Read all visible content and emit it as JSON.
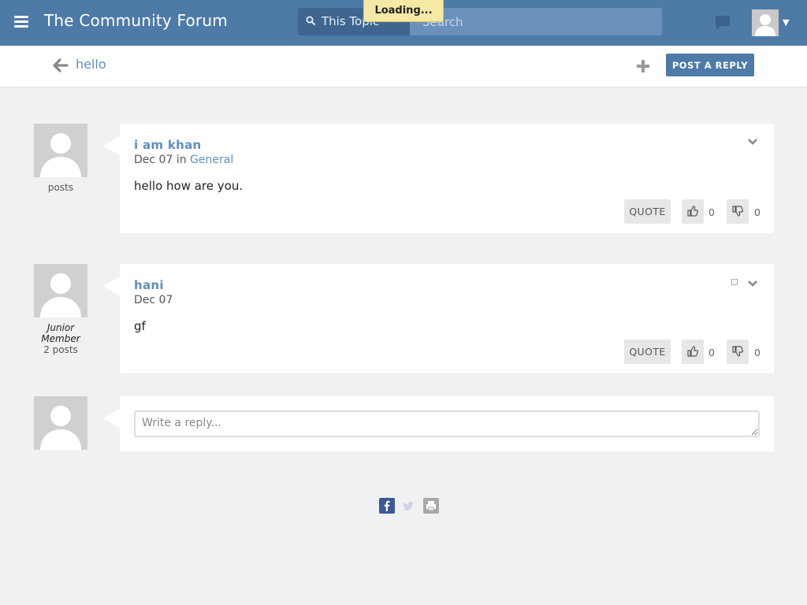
{
  "header": {
    "site_title": "The Community Forum",
    "search_scope": "This Topic",
    "search_placeholder": "Search",
    "loading_text": "Loading..."
  },
  "topic": {
    "title": "hello",
    "post_reply_label": "POST A REPLY"
  },
  "posts": [
    {
      "author": "i am khan",
      "date": "Dec 07",
      "in_word": "in",
      "category": "General",
      "body": "hello how are you.",
      "rank": "",
      "post_count": "posts",
      "quote_label": "QUOTE",
      "upvotes": "0",
      "downvotes": "0"
    },
    {
      "author": "hani",
      "date": "Dec 07",
      "body": "gf",
      "rank": "Junior Member",
      "post_count": "2 posts",
      "quote_label": "QUOTE",
      "upvotes": "0",
      "downvotes": "0"
    }
  ],
  "composer": {
    "placeholder": "Write a reply..."
  },
  "share": [
    "facebook-icon",
    "twitter-icon",
    "print-icon"
  ],
  "colors": {
    "header_bg": "#4e7aa8",
    "link": "#5e90c2",
    "page_bg": "#f0f1f3",
    "toast_bg": "#f6e9a6"
  }
}
